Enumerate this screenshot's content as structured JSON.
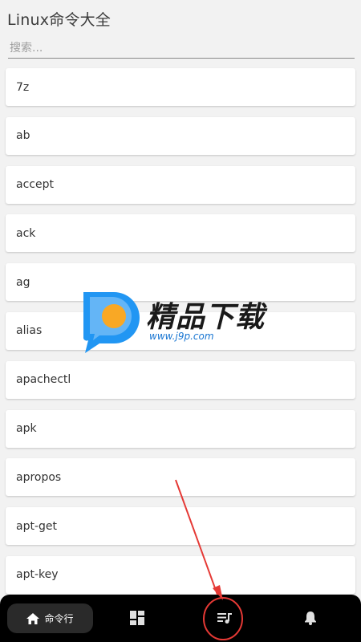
{
  "app": {
    "title": "Linux命令大全"
  },
  "search": {
    "placeholder": "搜索..."
  },
  "commands": [
    "7z",
    "ab",
    "accept",
    "ack",
    "ag",
    "alias",
    "apachectl",
    "apk",
    "apropos",
    "apt-get",
    "apt-key"
  ],
  "watermark": {
    "brand": "精品下载",
    "url": "www.j9p.com"
  },
  "bottom_nav": {
    "home_label": "命令行",
    "items": [
      {
        "icon": "home-icon"
      },
      {
        "icon": "dashboard-icon"
      },
      {
        "icon": "playlist-icon"
      },
      {
        "icon": "bell-icon"
      }
    ]
  },
  "colors": {
    "accent": "#1976d2",
    "annotation": "#e53935",
    "nav_bg": "#000000"
  }
}
